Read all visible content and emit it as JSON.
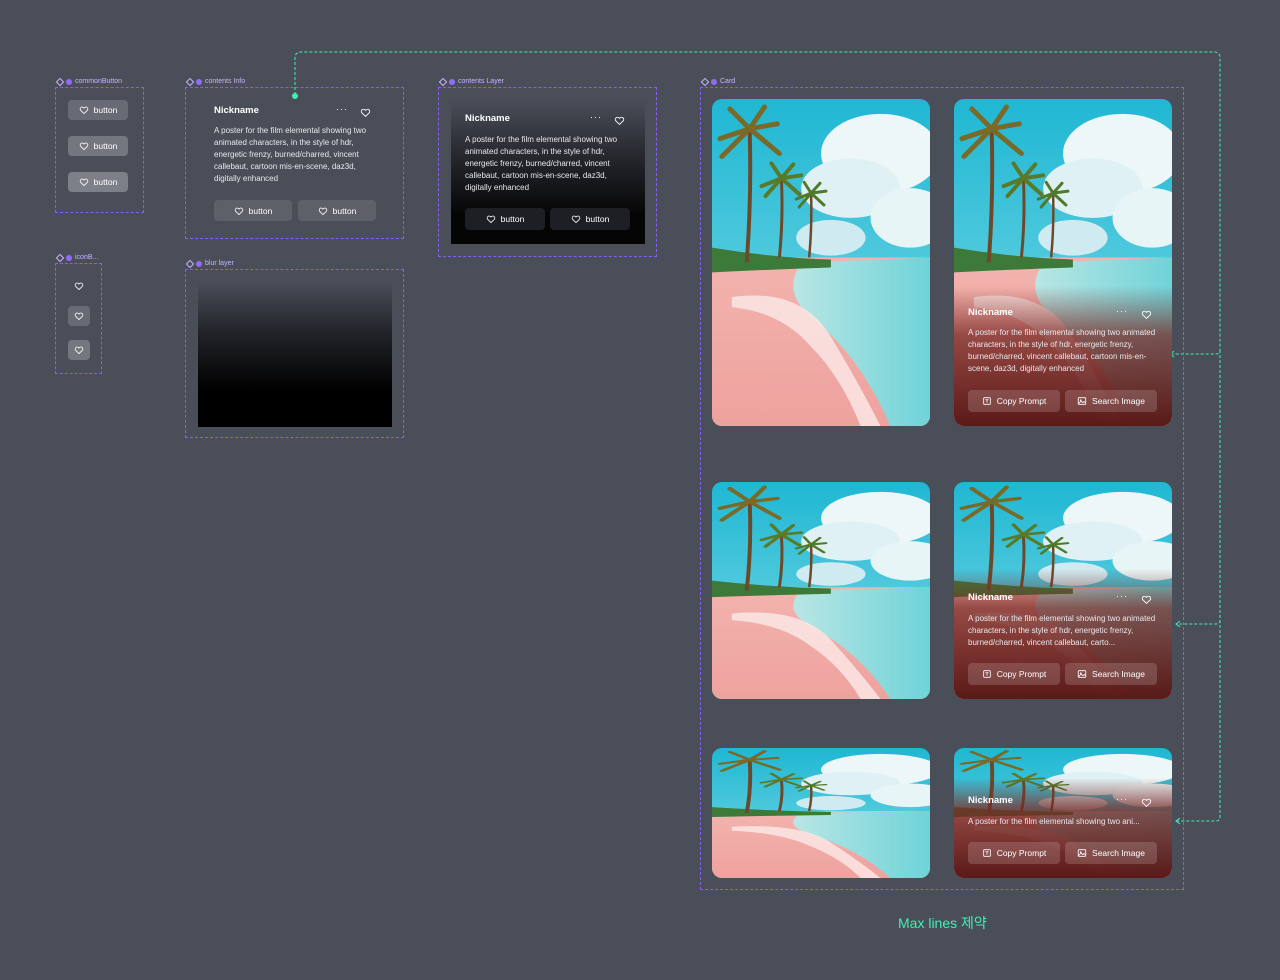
{
  "frames": {
    "common_button": "commonButton",
    "icon_button": "iconB...",
    "contents_info": "contents Info",
    "blur_layer": "blur layer",
    "contents_layer": "contents Layer",
    "card": "Card"
  },
  "common_button": {
    "label": "button"
  },
  "contents": {
    "nickname": "Nickname",
    "more": "···",
    "description": "A poster for the film elemental showing two animated characters, in the style of hdr, energetic frenzy, burned/charred, vincent callebaut, cartoon mis-en-scene, daz3d, digitally enhanced",
    "button_label": "button"
  },
  "card": {
    "nickname": "Nickname",
    "more": "···",
    "description": "A poster for the film elemental showing two animated characters, in the style of hdr, energetic frenzy, burned/charred, vincent callebaut, cartoon mis-en-scene, daz3d, digitally enhanced",
    "description_3line": "A poster for the film elemental showing two animated characters, in the style of hdr, energetic frenzy, burned/charred, vincent callebaut, carto...",
    "description_1line": "A poster for the film elemental showing two ani...",
    "copy_prompt": "Copy Prompt",
    "search_image": "Search Image"
  },
  "note": "Max lines 제약",
  "colors": {
    "canvas": "#4a4e59",
    "frame_border": "#8a5cf0",
    "connector": "#3ff0b4",
    "sky": "#2fc1d8",
    "sand": "#f2a6a4",
    "overlay_warm": "#7a2a26"
  },
  "icons": [
    "component-icon",
    "heart-icon",
    "more-icon",
    "copy-prompt-icon",
    "search-image-icon"
  ]
}
